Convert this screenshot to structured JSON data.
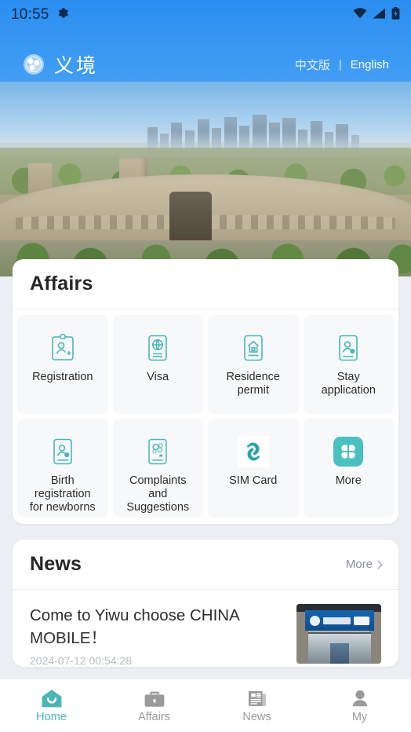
{
  "status_bar": {
    "time": "10:55",
    "icons": [
      "gear-icon",
      "wifi-icon",
      "cellular-signal-icon",
      "battery-charging-icon"
    ]
  },
  "app_bar": {
    "logo_icon": "yijing-globe-logo",
    "brand_name": "义境",
    "language": {
      "chinese_label": "中文版",
      "separator": "|",
      "english_label": "English"
    }
  },
  "hero": {
    "image_alt": "Aerial view of Yiwu International Trade City"
  },
  "affairs": {
    "title": "Affairs",
    "items": [
      {
        "label": "Registration",
        "icon": "id-card-person-add-icon"
      },
      {
        "label": "Visa",
        "icon": "passport-globe-icon"
      },
      {
        "label": "Residence\npermit",
        "icon": "house-document-icon"
      },
      {
        "label": "Stay\napplication",
        "icon": "person-card-clock-icon"
      },
      {
        "label": "Birth\nregistration\nfor newborns",
        "icon": "person-card-baby-icon"
      },
      {
        "label": "Complaints\nand\nSuggestions",
        "icon": "feedback-document-icon"
      },
      {
        "label": "SIM Card",
        "icon": "china-mobile-logo-icon"
      },
      {
        "label": "More",
        "icon": "grid-more-icon"
      }
    ]
  },
  "news": {
    "title": "News",
    "more_label": "More",
    "more_icon": "chevron-right-icon",
    "items": [
      {
        "title": "Come to Yiwu choose CHINA MOBILE！",
        "time": "2024-07-12 00:54:28",
        "thumb_alt": "China Mobile 5G store front"
      }
    ]
  },
  "tab_bar": {
    "items": [
      {
        "label": "Home",
        "icon": "home-icon",
        "active": true
      },
      {
        "label": "Affairs",
        "icon": "briefcase-icon",
        "active": false
      },
      {
        "label": "News",
        "icon": "newspaper-icon",
        "active": false
      },
      {
        "label": "My",
        "icon": "person-icon",
        "active": false
      }
    ]
  },
  "colors": {
    "accent_teal": "#4bb6b7",
    "header_blue": "#2a8ef0",
    "page_background": "#eceef3",
    "card_background": "#ffffff",
    "tile_background": "#f7f8f9",
    "text_primary": "#2c2c2c",
    "text_muted": "#9a9a9a"
  }
}
